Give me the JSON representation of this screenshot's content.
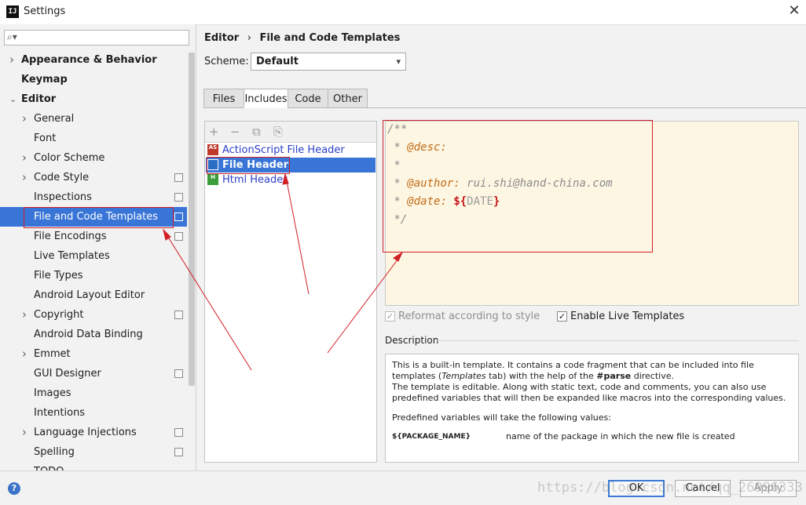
{
  "window": {
    "app_icon": "IJ",
    "title": "Settings",
    "close": "✕"
  },
  "search": {
    "icon": "⌕▾",
    "placeholder": ""
  },
  "sidebar": {
    "items": [
      {
        "label": "Appearance & Behavior",
        "expand": "right",
        "level": 0,
        "bold": true
      },
      {
        "label": "Keymap",
        "level": 0,
        "bold": true
      },
      {
        "label": "Editor",
        "expand": "down",
        "level": 0,
        "bold": true
      },
      {
        "label": "General",
        "expand": "right",
        "level": 1
      },
      {
        "label": "Font",
        "level": 1
      },
      {
        "label": "Color Scheme",
        "expand": "right",
        "level": 1
      },
      {
        "label": "Code Style",
        "expand": "right",
        "level": 1,
        "copy": true
      },
      {
        "label": "Inspections",
        "level": 1,
        "copy": true
      },
      {
        "label": "File and Code Templates",
        "level": 1,
        "copy": true,
        "selected": true
      },
      {
        "label": "File Encodings",
        "level": 1,
        "copy": true
      },
      {
        "label": "Live Templates",
        "level": 1
      },
      {
        "label": "File Types",
        "level": 1
      },
      {
        "label": "Android Layout Editor",
        "level": 1
      },
      {
        "label": "Copyright",
        "expand": "right",
        "level": 1,
        "copy": true
      },
      {
        "label": "Android Data Binding",
        "level": 1
      },
      {
        "label": "Emmet",
        "expand": "right",
        "level": 1
      },
      {
        "label": "GUI Designer",
        "level": 1,
        "copy": true
      },
      {
        "label": "Images",
        "level": 1
      },
      {
        "label": "Intentions",
        "level": 1
      },
      {
        "label": "Language Injections",
        "expand": "right",
        "level": 1,
        "copy": true
      },
      {
        "label": "Spelling",
        "level": 1,
        "copy": true
      },
      {
        "label": "TODO",
        "level": 1
      }
    ]
  },
  "breadcrumb": {
    "parent": "Editor",
    "sep": "›",
    "current": "File and Code Templates"
  },
  "scheme": {
    "label": "Scheme:",
    "value": "Default",
    "chevron": "▾"
  },
  "tabs": [
    {
      "label": "Files"
    },
    {
      "label": "Includes",
      "active": true
    },
    {
      "label": "Code"
    },
    {
      "label": "Other"
    }
  ],
  "list_toolbar": {
    "add": "+",
    "remove": "−",
    "copy": "⧉",
    "reset": "⎘"
  },
  "templates": [
    {
      "name": "ActionScript File Header",
      "icon": "AS",
      "color": "#c0392b"
    },
    {
      "name": "File Header",
      "icon": "",
      "color": "#2b6cc4",
      "selected": true
    },
    {
      "name": "Html Header",
      "icon": "H",
      "color": "#3a9c3a"
    }
  ],
  "editor": {
    "line1": "/**",
    "line2_star": " * ",
    "line2_tag": "@desc:",
    "line3": " *",
    "line4_star": " * ",
    "line4_tag": "@author:",
    "line4_val": " rui.shi@hand-china.com",
    "line5_star": " * ",
    "line5_tag": "@date:",
    "line5_dollar": " $",
    "line5_open": "{",
    "line5_var": "DATE",
    "line5_close": "}",
    "line6": " */"
  },
  "options": {
    "reformat": {
      "label": "Reformat according to style",
      "checked": true,
      "disabled": true
    },
    "live_templates": {
      "label": "Enable Live Templates",
      "checked": true
    }
  },
  "description": {
    "title": "Description",
    "p1_a": "This is a built-in template. It contains a code fragment that can be included into file templates (",
    "p1_em": "Templates",
    "p1_b": " tab) with the help of the ",
    "p1_strong": "#parse",
    "p1_c": " directive.",
    "p2": "The template is editable. Along with static text, code and comments, you can also use predefined variables that will then be expanded like macros into the corresponding values.",
    "p3": "Predefined variables will take the following values:",
    "var_name": "${PACKAGE_NAME}",
    "var_desc": "name of the package in which the new file is created"
  },
  "footer": {
    "help": "?",
    "ok": "OK",
    "cancel": "Cancel",
    "apply": "Apply",
    "watermark": "https://blog.csdn.net/qq_26996333"
  },
  "colors": {
    "selection": "#3875d7",
    "annotation_red": "#d21f26",
    "editor_bg": "#fdf6e3",
    "link_blue": "#2a3ec8"
  }
}
